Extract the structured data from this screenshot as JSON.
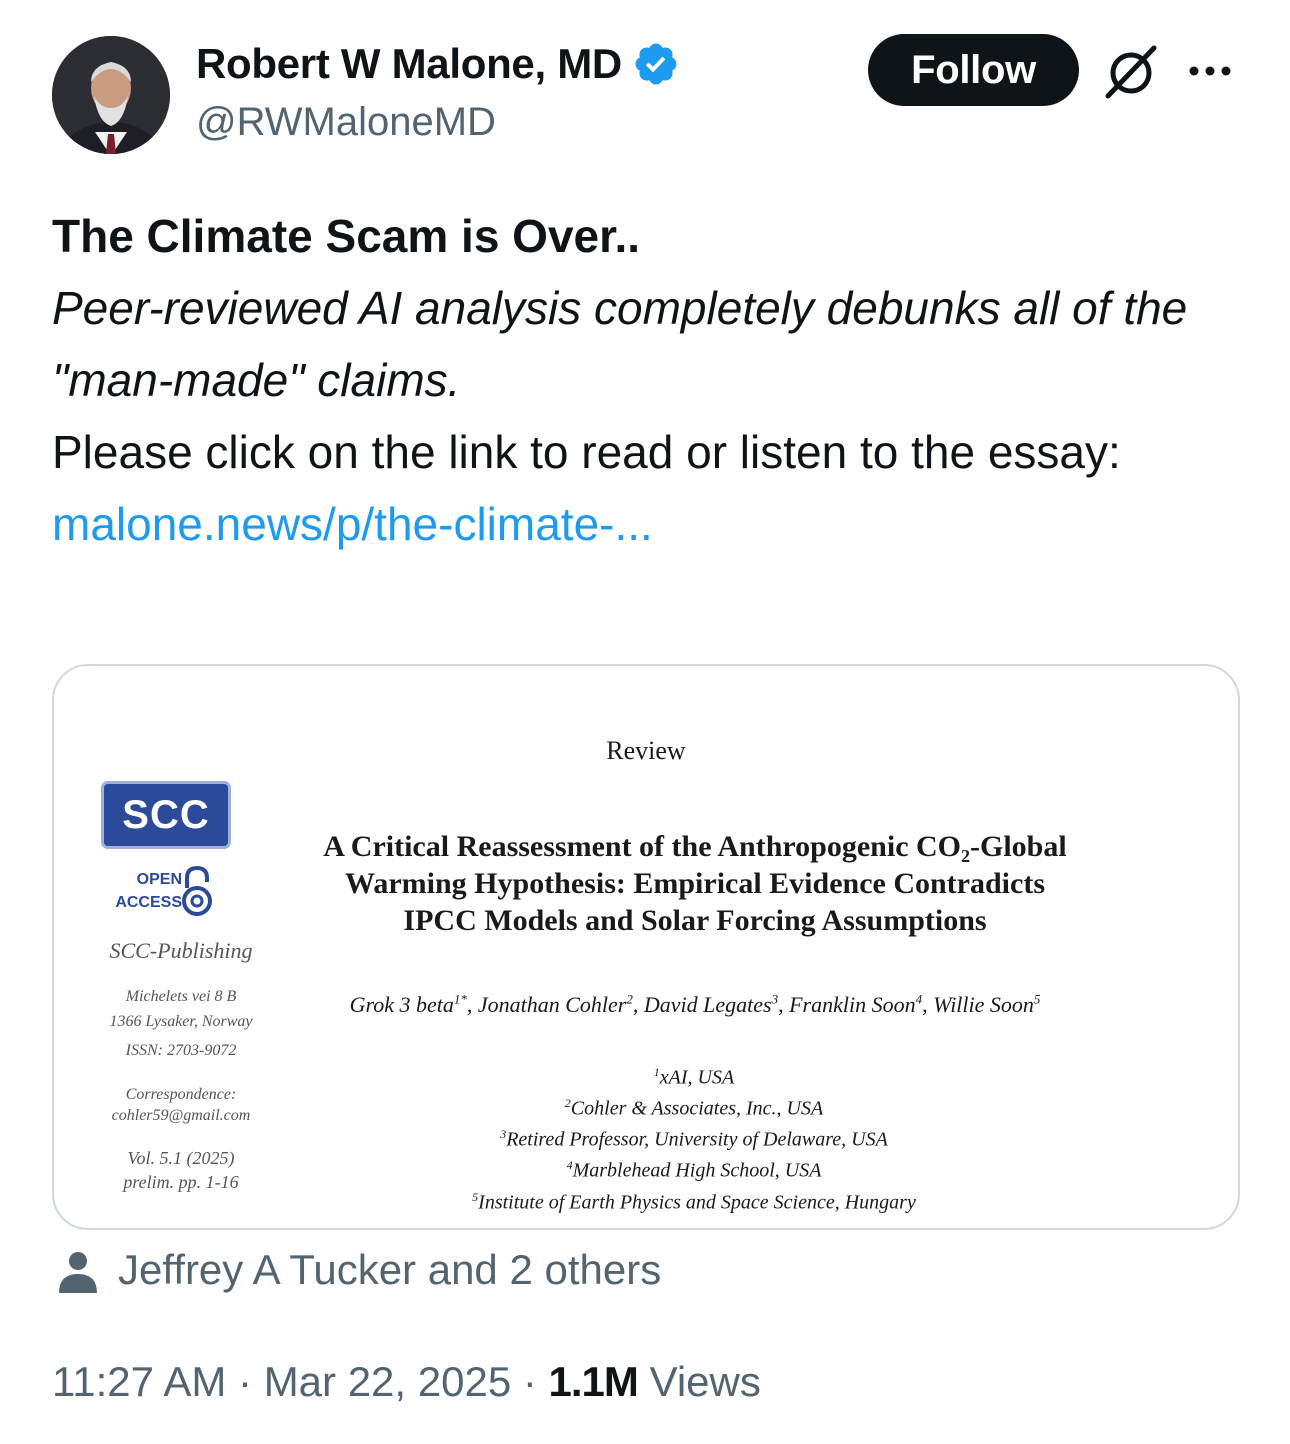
{
  "author": {
    "name": "Robert W Malone, MD",
    "handle": "@RWMaloneMD",
    "verified_icon": "verified-badge-icon",
    "verified_color": "#1d9bf0"
  },
  "header": {
    "follow_label": "Follow",
    "grok_icon": "grok-icon",
    "more_icon": "more-icon"
  },
  "tweet": {
    "title": "The Climate Scam is Over..",
    "subtitle": "Peer-reviewed AI analysis completely debunks all of the \"man-made\" claims.",
    "body": "Please click on the link to read or listen to the essay:",
    "link_text": "malone.news/p/the-climate-...",
    "link_color": "#1d9bf0"
  },
  "card": {
    "review_label": "Review",
    "logo_text": "SCC",
    "open_access": [
      "OPEN",
      "ACCESS"
    ],
    "publisher": "SCC-Publishing",
    "address": [
      "Michelets vei 8 B",
      "1366 Lysaker, Norway"
    ],
    "issn": "ISSN: 2703-9072",
    "correspondence": [
      "Correspondence:",
      "cohler59@gmail.com"
    ],
    "volume": [
      "Vol. 5.1 (2025)",
      "prelim. pp. 1-16"
    ],
    "title_lines": [
      "A Critical Reassessment of the Anthropogenic CO₂-Global",
      "Warming Hypothesis: Empirical Evidence Contradicts",
      "IPCC Models and Solar Forcing Assumptions"
    ],
    "authors": [
      {
        "name": "Grok 3 beta",
        "sup": "1*",
        "sep": ", "
      },
      {
        "name": "Jonathan Cohler",
        "sup": "2",
        "sep": ", "
      },
      {
        "name": "David Legates",
        "sup": "3",
        "sep": ", "
      },
      {
        "name": "Franklin Soon",
        "sup": "4",
        "sep": ", "
      },
      {
        "name": "Willie Soon",
        "sup": "5",
        "sep": ""
      }
    ],
    "affiliations": [
      {
        "sup": "1",
        "text": "xAI, USA"
      },
      {
        "sup": "2",
        "text": "Cohler & Associates, Inc., USA"
      },
      {
        "sup": "3",
        "text": "Retired Professor, University of Delaware, USA"
      },
      {
        "sup": "4",
        "text": "Marblehead High School, USA"
      },
      {
        "sup": "5",
        "text": "Institute of Earth Physics and Space Science, Hungary"
      }
    ]
  },
  "social_context": {
    "icon": "person-icon",
    "text": "Jeffrey A Tucker and 2 others"
  },
  "meta": {
    "time": "11:27 AM",
    "separator": "·",
    "date": "Mar 22, 2025",
    "views_count": "1.1M",
    "views_label": "Views"
  }
}
